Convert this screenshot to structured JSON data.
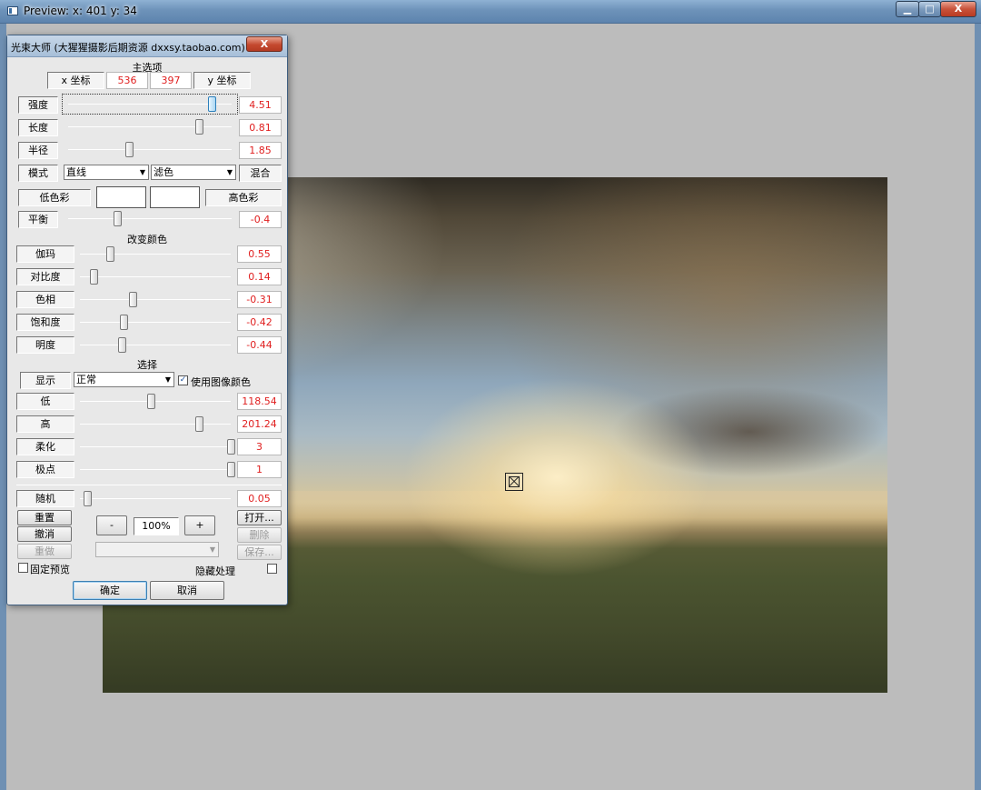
{
  "window": {
    "title": "Preview:  x: 401 y: 34",
    "min_glyph": "▁",
    "max_glyph": "□",
    "close_glyph": "X"
  },
  "dialog": {
    "title": "光束大师 (大猩猩摄影后期资源 dxxsy.taobao.com)",
    "close_glyph": "X",
    "main_section": {
      "title": "主选项",
      "x_label": "x 坐标",
      "x_value": "536",
      "y_value": "397",
      "y_label": "y 坐标",
      "strength": {
        "label": "强度",
        "value": "4.51",
        "level": 0.88
      },
      "length": {
        "label": "长度",
        "value": "0.81",
        "level": 0.8
      },
      "radius": {
        "label": "半径",
        "value": "1.85",
        "level": 0.37
      },
      "mode": {
        "label": "模式",
        "shape": "直线",
        "blend": "滤色",
        "blend_button": "混合"
      },
      "low_color_label": "低色彩",
      "high_color_label": "高色彩",
      "balance": {
        "label": "平衡",
        "value": "-0.4",
        "level": 0.3
      }
    },
    "color_section": {
      "title": "改变颜色",
      "gamma": {
        "label": "伽玛",
        "value": "0.55",
        "level": 0.2
      },
      "contrast": {
        "label": "对比度",
        "value": "0.14",
        "level": 0.09
      },
      "hue": {
        "label": "色相",
        "value": "-0.31",
        "level": 0.35
      },
      "saturation": {
        "label": "饱和度",
        "value": "-0.42",
        "level": 0.29
      },
      "brightness": {
        "label": "明度",
        "value": "-0.44",
        "level": 0.28
      }
    },
    "select_section": {
      "title": "选择",
      "display_label": "显示",
      "display_value": "正常",
      "use_image_color_label": "使用图像颜色",
      "use_image_color_checked": true,
      "low": {
        "label": "低",
        "value": "118.54",
        "level": 0.47
      },
      "high": {
        "label": "高",
        "value": "201.24",
        "level": 0.79
      },
      "soften": {
        "label": "柔化",
        "value": "3",
        "level": 1.0
      },
      "pole": {
        "label": "极点",
        "value": "1",
        "level": 1.0
      }
    },
    "random": {
      "label": "随机",
      "value": "0.05",
      "level": 0.05
    },
    "buttons": {
      "reset": "重置",
      "undo": "撤消",
      "redo": "重做",
      "zoom_out": "-",
      "zoom_level": "100%",
      "zoom_in": "+",
      "open": "打开...",
      "delete": "删除",
      "save": "保存...",
      "ok": "确定",
      "cancel": "取消"
    },
    "fixed_preview_label": "固定预览",
    "hide_processing_label": "隐藏处理",
    "combo_arrow": "▼"
  }
}
